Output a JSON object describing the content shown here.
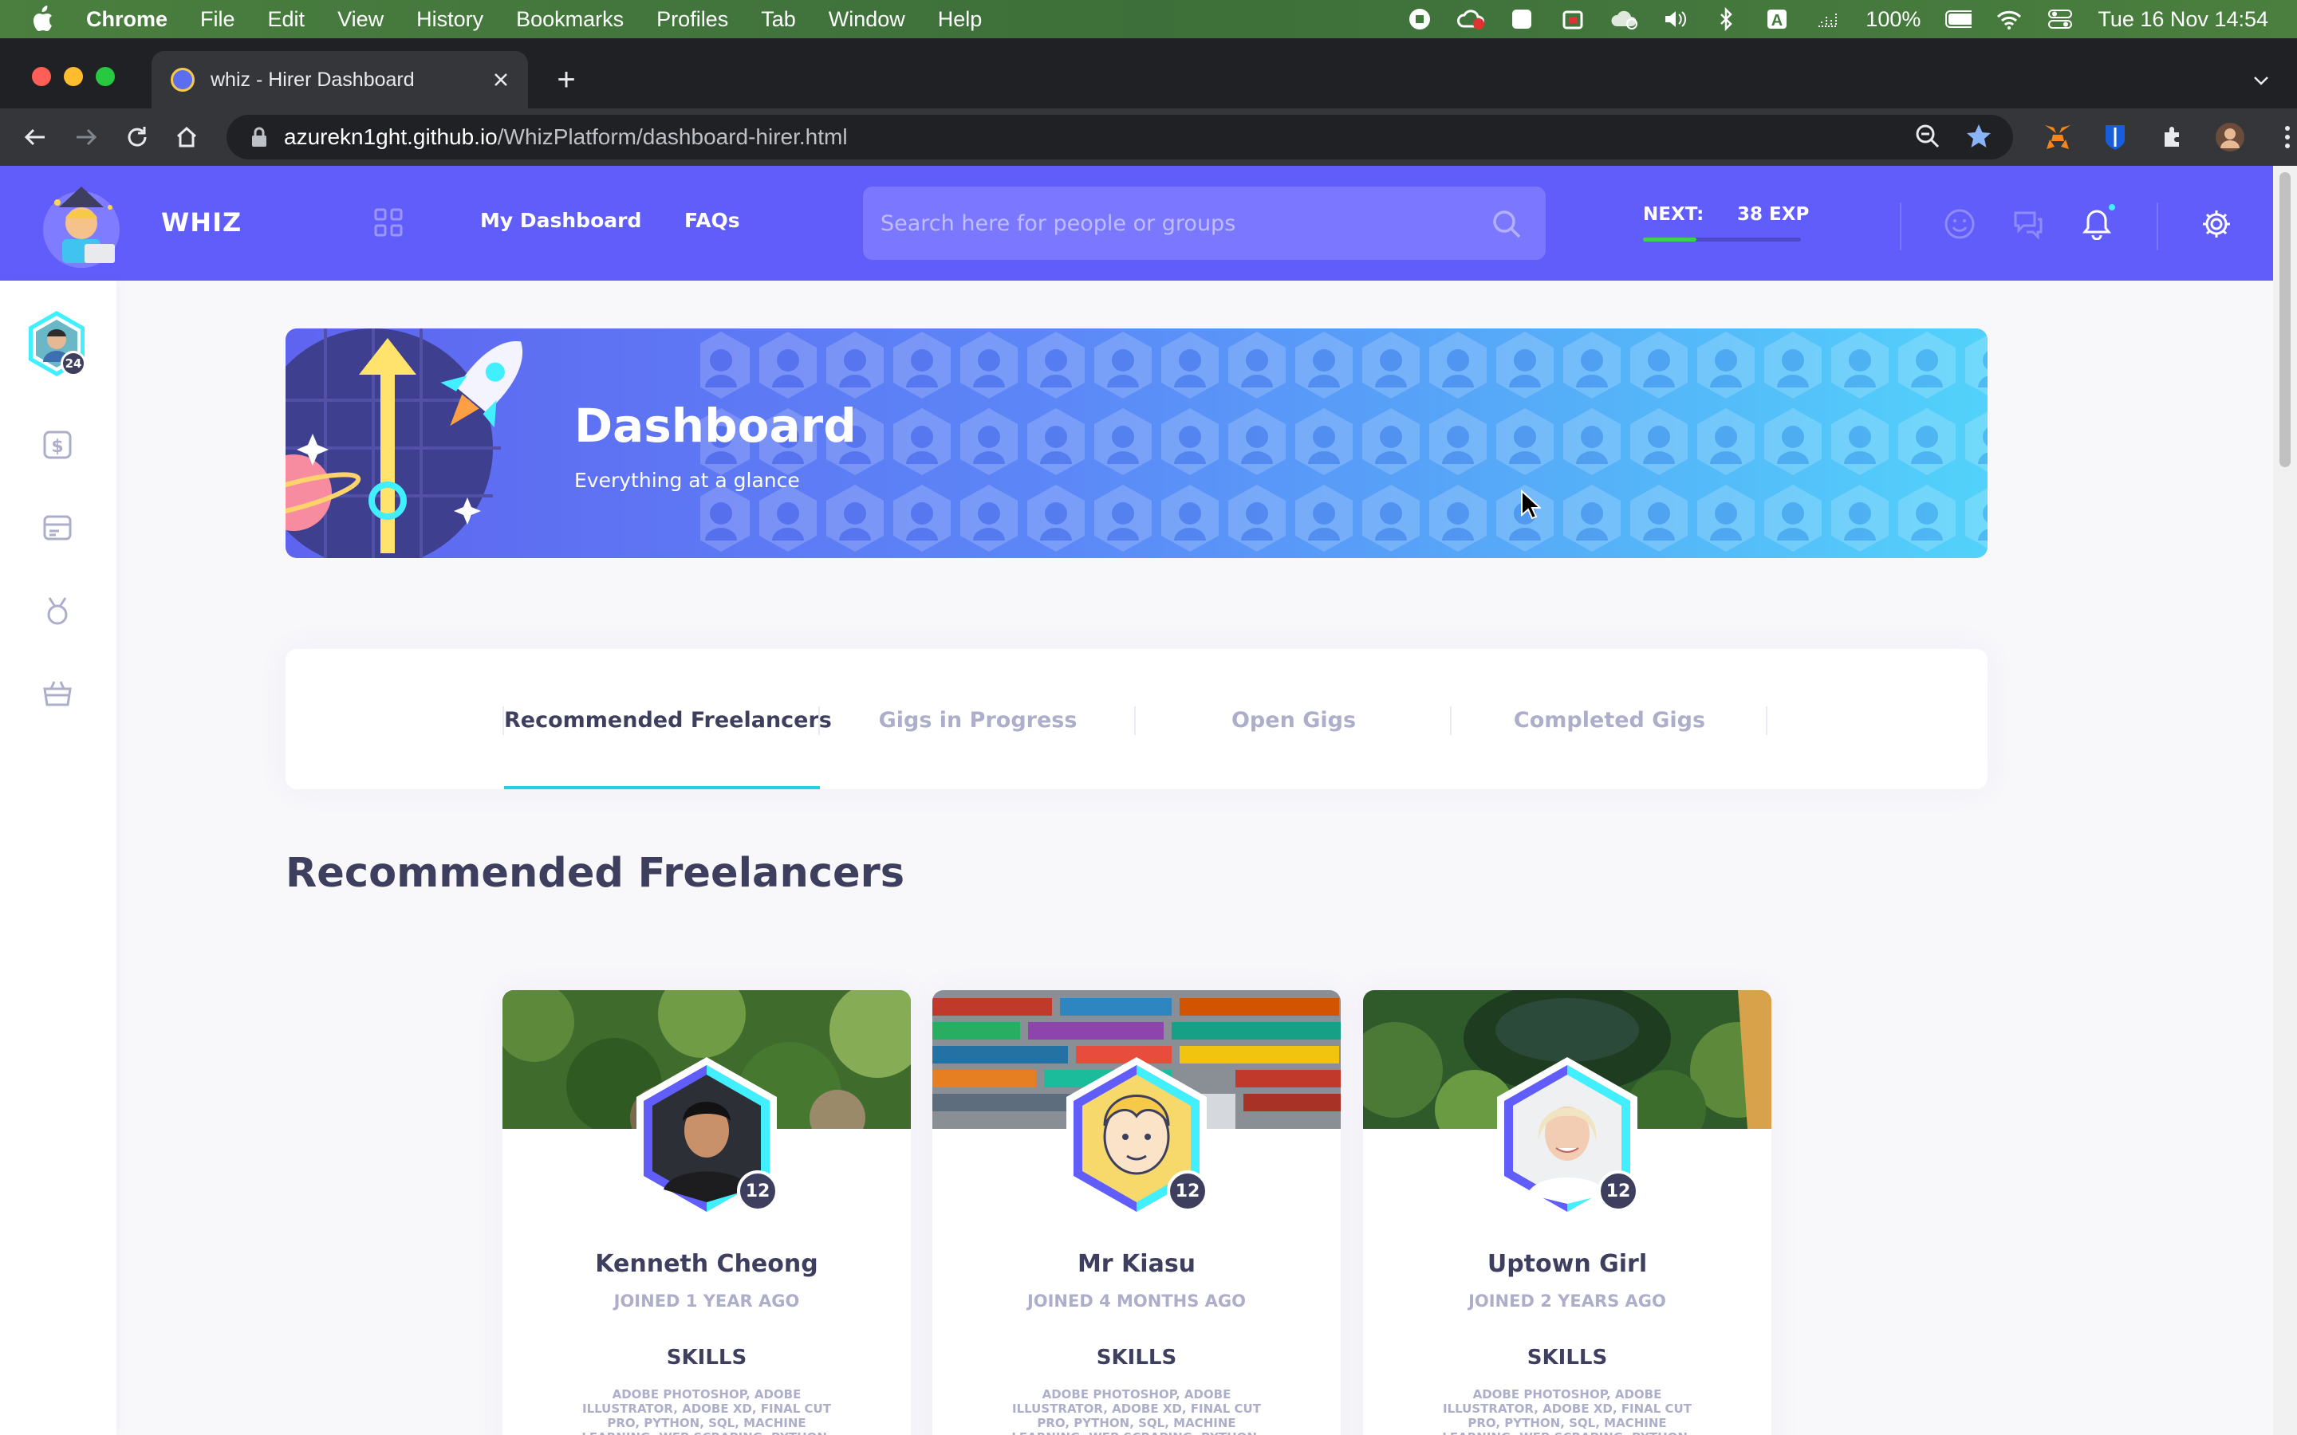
{
  "menubar": {
    "app": "Chrome",
    "items": [
      "File",
      "Edit",
      "View",
      "History",
      "Bookmarks",
      "Profiles",
      "Tab",
      "Window",
      "Help"
    ],
    "battery": "100%",
    "datetime": "Tue 16 Nov  14:54"
  },
  "browser": {
    "tab_title": "whiz - Hirer Dashboard",
    "url_host": "azurekn1ght.github.io",
    "url_path": "/WhizPlatform/dashboard-hirer.html"
  },
  "header": {
    "brand": "WHIZ",
    "nav": [
      "My Dashboard",
      "FAQs"
    ],
    "search_placeholder": "Search here for people or groups",
    "exp_label": "NEXT:",
    "exp_value": "38 EXP",
    "exp_progress": 0.34,
    "colors": {
      "header": "#615dfa",
      "accent": "#23d2e2"
    }
  },
  "sidebar": {
    "level": "24"
  },
  "banner": {
    "title": "Dashboard",
    "subtitle": "Everything at a glance"
  },
  "tabs": [
    {
      "label": "Recommended Freelancers",
      "active": true
    },
    {
      "label": "Gigs in Progress",
      "active": false
    },
    {
      "label": "Open Gigs",
      "active": false
    },
    {
      "label": "Completed Gigs",
      "active": false
    }
  ],
  "section_title": "Recommended Freelancers",
  "freelancers": [
    {
      "name": "Kenneth Cheong",
      "joined": "JOINED 1 YEAR AGO",
      "level": "12",
      "skills_title": "SKILLS",
      "skills": "ADOBE PHOTOSHOP, ADOBE ILLUSTRATOR, ADOBE XD, FINAL CUT PRO, PYTHON, SQL, MACHINE LEARNING, WEB SCRAPING, PYTHON, SQL, MACHINE"
    },
    {
      "name": "Mr Kiasu",
      "joined": "JOINED 4 MONTHS AGO",
      "level": "12",
      "skills_title": "SKILLS",
      "skills": "ADOBE PHOTOSHOP, ADOBE ILLUSTRATOR, ADOBE XD, FINAL CUT PRO, PYTHON, SQL, MACHINE LEARNING, WEB SCRAPING, PYTHON, SQL, MACHINE"
    },
    {
      "name": "Uptown Girl",
      "joined": "JOINED 2 YEARS AGO",
      "level": "12",
      "skills_title": "SKILLS",
      "skills": "ADOBE PHOTOSHOP, ADOBE ILLUSTRATOR, ADOBE XD, FINAL CUT PRO, PYTHON, SQL, MACHINE LEARNING, WEB SCRAPING, PYTHON, SQL, MACHINE"
    }
  ]
}
